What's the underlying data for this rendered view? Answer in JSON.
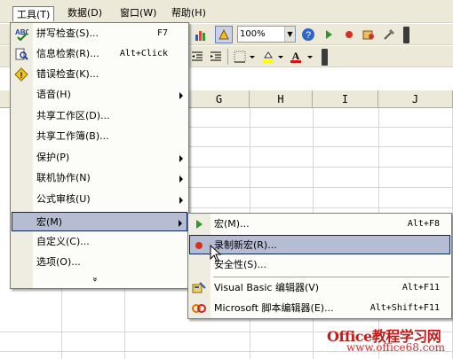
{
  "menubar": {
    "items": [
      "工具(T)",
      "数据(D)",
      "窗口(W)",
      "帮助(H)"
    ]
  },
  "toolbar": {
    "zoom_value": "100%"
  },
  "grid": {
    "columns": [
      "G",
      "H",
      "I",
      "J"
    ]
  },
  "tools_menu": {
    "items": [
      {
        "label": "拼写检查(S)...",
        "shortcut": "F7",
        "icon": "spell-check-icon"
      },
      {
        "label": "信息检索(R)...",
        "shortcut": "Alt+Click",
        "icon": "research-icon"
      },
      {
        "label": "错误检查(K)...",
        "shortcut": "",
        "icon": "error-check-icon"
      },
      {
        "label": "语音(H)",
        "shortcut": "",
        "icon": ""
      },
      {
        "label": "共享工作区(D)...",
        "shortcut": "",
        "icon": ""
      },
      {
        "label": "共享工作簿(B)...",
        "shortcut": "",
        "icon": ""
      },
      {
        "label": "保护(P)",
        "shortcut": "",
        "icon": ""
      },
      {
        "label": "联机协作(N)",
        "shortcut": "",
        "icon": ""
      },
      {
        "label": "公式审核(U)",
        "shortcut": "",
        "icon": ""
      },
      {
        "label": "宏(M)",
        "shortcut": "",
        "icon": ""
      },
      {
        "label": "自定义(C)...",
        "shortcut": "",
        "icon": ""
      },
      {
        "label": "选项(O)...",
        "shortcut": "",
        "icon": ""
      }
    ],
    "more": "»"
  },
  "macro_submenu": {
    "items": [
      {
        "label": "宏(M)...",
        "shortcut": "Alt+F8",
        "icon": "play-macro-icon"
      },
      {
        "label": "录制新宏(R)...",
        "shortcut": "",
        "icon": "record-icon"
      },
      {
        "label": "安全性(S)...",
        "shortcut": "",
        "icon": ""
      },
      {
        "label": "Visual Basic 编辑器(V)",
        "shortcut": "Alt+F11",
        "icon": "vb-editor-icon"
      },
      {
        "label": "Microsoft 脚本编辑器(E)...",
        "shortcut": "Alt+Shift+F11",
        "icon": "script-editor-icon"
      }
    ]
  },
  "watermark": {
    "line1": "Office教程学习网",
    "line2": "www.office68.com"
  }
}
